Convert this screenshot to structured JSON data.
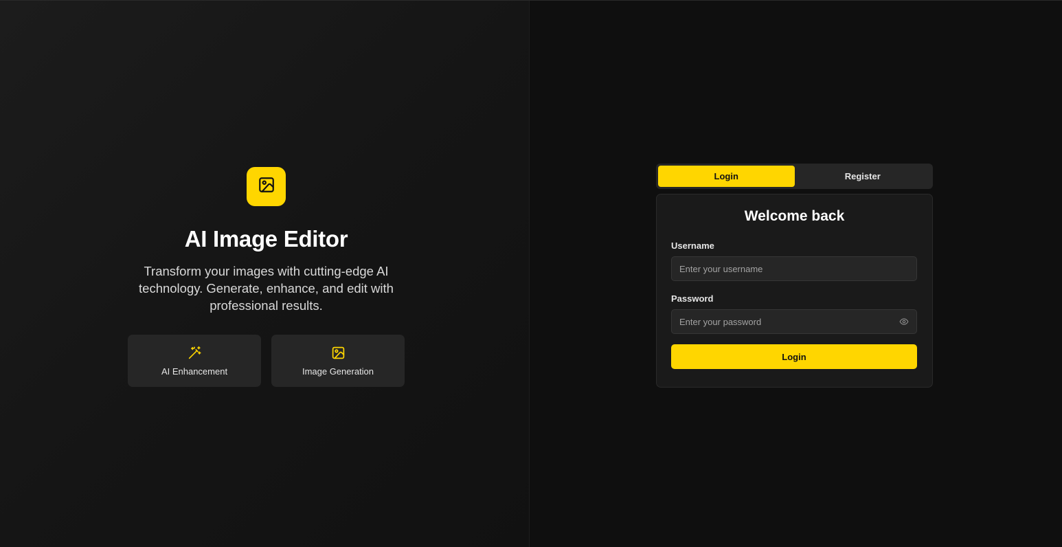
{
  "hero": {
    "title": "AI Image Editor",
    "description": "Transform your images with cutting-edge AI technology. Generate, enhance, and edit with professional results.",
    "logo_icon": "image-icon",
    "features": [
      {
        "label": "AI Enhancement",
        "icon": "magic-wand-icon"
      },
      {
        "label": "Image Generation",
        "icon": "image-icon"
      }
    ]
  },
  "auth": {
    "tabs": [
      {
        "label": "Login",
        "active": true
      },
      {
        "label": "Register",
        "active": false
      }
    ],
    "title": "Welcome back",
    "username": {
      "label": "Username",
      "placeholder": "Enter your username",
      "value": ""
    },
    "password": {
      "label": "Password",
      "placeholder": "Enter your password",
      "value": "",
      "toggle_icon": "eye-icon"
    },
    "submit_label": "Login"
  },
  "colors": {
    "accent": "#ffd600",
    "background": "#101010",
    "card": "#1a1a1a",
    "input": "#262626"
  }
}
